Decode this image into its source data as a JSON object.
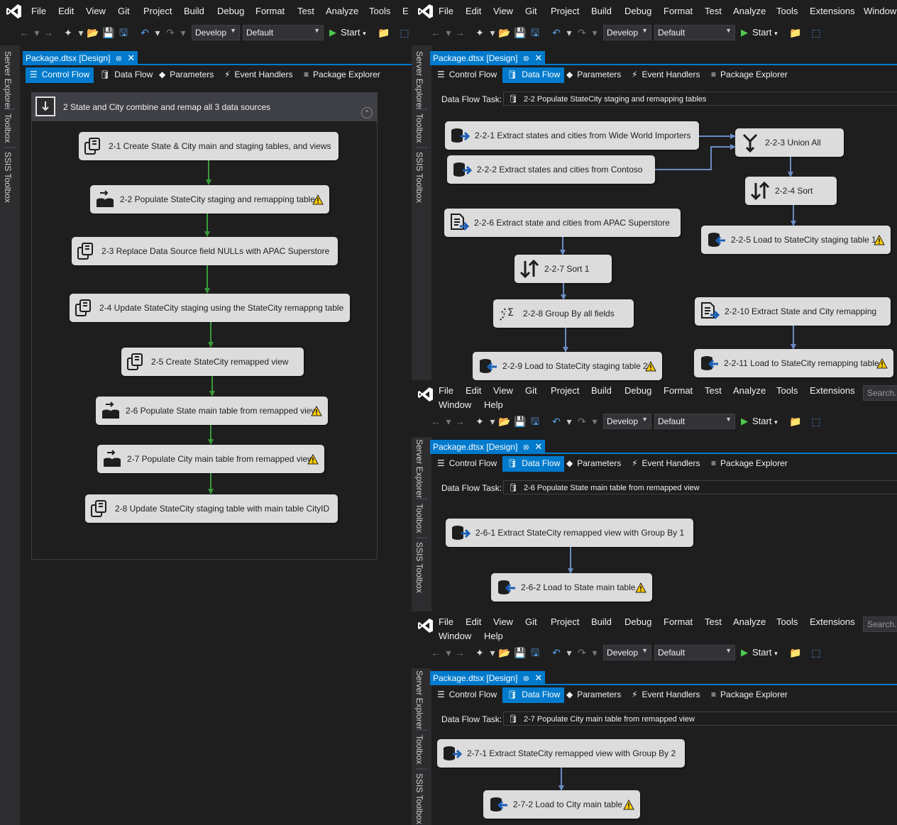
{
  "menu_top_left": [
    "File",
    "Edit",
    "View",
    "Git",
    "Project",
    "Build",
    "Debug",
    "Format",
    "Test",
    "Analyze",
    "Tools",
    "E"
  ],
  "menu_top_right": [
    "File",
    "Edit",
    "View",
    "Git",
    "Project",
    "Build",
    "Debug",
    "Format",
    "Test",
    "Analyze",
    "Tools",
    "Extensions",
    "Window"
  ],
  "menu_row1": [
    "File",
    "Edit",
    "View",
    "Git",
    "Project",
    "Build",
    "Debug",
    "Format",
    "Test",
    "Analyze",
    "Tools",
    "Extensions"
  ],
  "menu_row2": [
    "Window",
    "Help"
  ],
  "search_placeholder": "Search...",
  "toolbar": {
    "config": "Develop",
    "platform": "Default",
    "start": "Start"
  },
  "side_tabs": [
    "Server Explorer",
    "Toolbox",
    "SSIS Toolbox"
  ],
  "doc_tab": "Package.dtsx [Design]",
  "designer_tabs": [
    "Control Flow",
    "Data Flow",
    "Parameters",
    "Event Handlers",
    "Package Explorer"
  ],
  "data_flow_task_label": "Data Flow Task:",
  "colors": {
    "accent": "#007acc",
    "node_bg": "#dcdcdc",
    "green_arrow": "#3a9a3a",
    "blue_arrow": "#6a8cc4",
    "warn": "#ffcc00"
  },
  "control_flow": {
    "container_title": "2  State and City combine and remap all 3 data sources",
    "tasks": [
      {
        "label": "2-1  Create State & City main and staging tables, and views",
        "icon": "sql-task-icon",
        "warn": false
      },
      {
        "label": "2-2  Populate StateCity staging and remapping tables",
        "icon": "data-flow-task-icon",
        "warn": true
      },
      {
        "label": "2-3  Replace Data Source field NULLs with APAC Superstore",
        "icon": "sql-task-icon",
        "warn": false
      },
      {
        "label": "2-4  Update StateCity staging using the StateCity remappng table",
        "icon": "sql-task-icon",
        "warn": false
      },
      {
        "label": "2-5  Create StateCity remapped view",
        "icon": "sql-task-icon",
        "warn": false
      },
      {
        "label": "2-6  Populate State main table from remapped view",
        "icon": "data-flow-task-icon",
        "warn": true
      },
      {
        "label": "2-7  Populate City main table from remapped view",
        "icon": "data-flow-task-icon",
        "warn": true
      },
      {
        "label": "2-8  Update StateCity staging table with main table CityID",
        "icon": "sql-task-icon",
        "warn": false
      }
    ]
  },
  "df22": {
    "task": "2-2  Populate StateCity staging and remapping tables",
    "nodes": [
      {
        "label": "2-2-1  Extract states and cities from Wide World Importers",
        "icon": "ole-db-source-icon",
        "warn": false
      },
      {
        "label": "2-2-2  Extract states and cities from Contoso",
        "icon": "ole-db-source-icon",
        "warn": false
      },
      {
        "label": "2-2-3  Union All",
        "icon": "union-all-icon",
        "warn": false
      },
      {
        "label": "2-2-4  Sort",
        "icon": "sort-icon",
        "warn": false
      },
      {
        "label": "2-2-5  Load to StateCity staging table 1",
        "icon": "ole-db-destination-icon",
        "warn": true
      },
      {
        "label": "2-2-6  Extract state and cities from APAC Superstore",
        "icon": "flat-file-source-icon",
        "warn": false
      },
      {
        "label": "2-2-7  Sort 1",
        "icon": "sort-icon",
        "warn": false
      },
      {
        "label": "2-2-8  Group By all fields",
        "icon": "aggregate-icon",
        "warn": false
      },
      {
        "label": "2-2-9  Load to StateCity staging table 2",
        "icon": "ole-db-destination-icon",
        "warn": true
      },
      {
        "label": "2-2-10  Extract State and City remapping",
        "icon": "flat-file-source-icon",
        "warn": false
      },
      {
        "label": "2-2-11  Load to StateCity remapping table",
        "icon": "ole-db-destination-icon",
        "warn": true
      }
    ]
  },
  "df26": {
    "task": "2-6  Populate State main table from remapped view",
    "nodes": [
      {
        "label": "2-6-1  Extract StateCity remapped view with Group By 1",
        "icon": "ole-db-source-icon",
        "warn": false
      },
      {
        "label": "2-6-2  Load to State main table",
        "icon": "ole-db-destination-icon",
        "warn": true
      }
    ]
  },
  "df27": {
    "task": "2-7  Populate City main table from remapped view",
    "nodes": [
      {
        "label": "2-7-1  Extract StateCity remapped view with Group By 2",
        "icon": "ole-db-source-icon",
        "warn": false
      },
      {
        "label": "2-7-2  Load to City main table",
        "icon": "ole-db-destination-icon",
        "warn": true
      }
    ]
  }
}
